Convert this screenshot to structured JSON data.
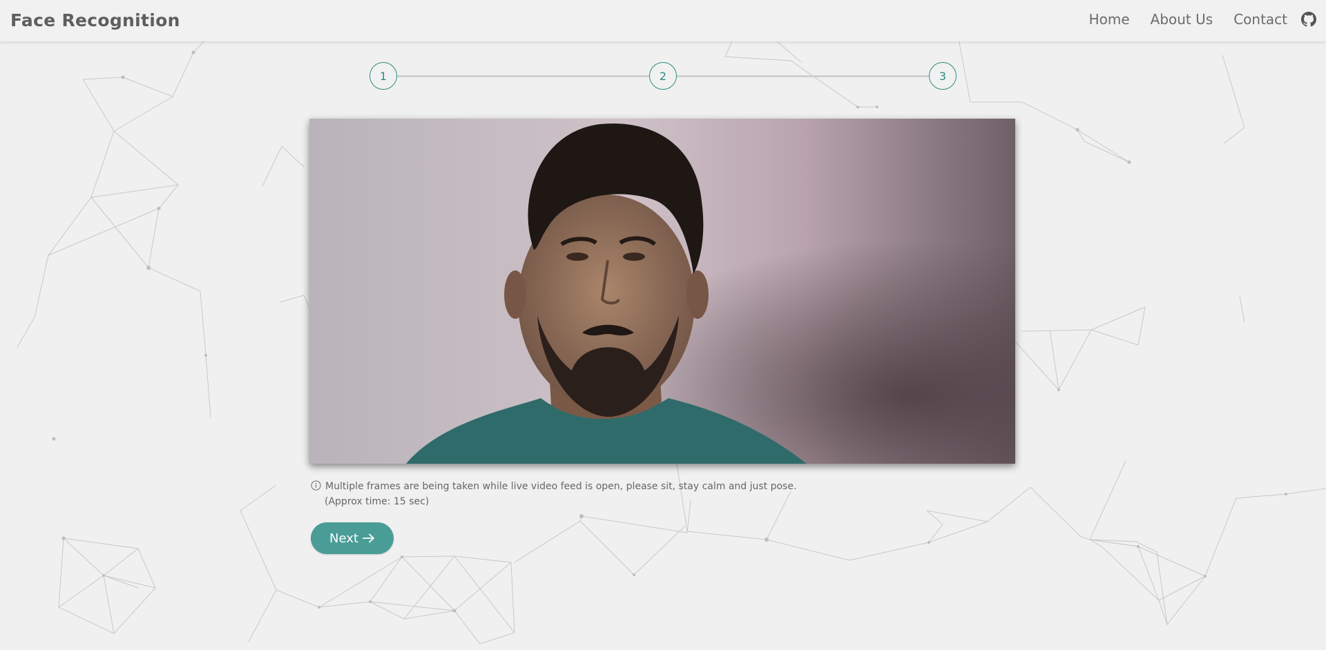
{
  "navbar": {
    "brand": "Face Recognition",
    "links": [
      "Home",
      "About Us",
      "Contact"
    ]
  },
  "stepper": {
    "steps": [
      "1",
      "2",
      "3"
    ]
  },
  "video": {
    "icon": "webcam-feed-person"
  },
  "info": {
    "message": "Multiple frames are being taken while live video feed is open, please sit, stay calm and just pose.",
    "time_note": "(Approx time: 15 sec)"
  },
  "actions": {
    "next_label": "Next",
    "next_icon": "arrow-right-icon"
  },
  "colors": {
    "accent": "#2e8b80",
    "button": "#4a9d97",
    "background": "#f0f0f0"
  }
}
